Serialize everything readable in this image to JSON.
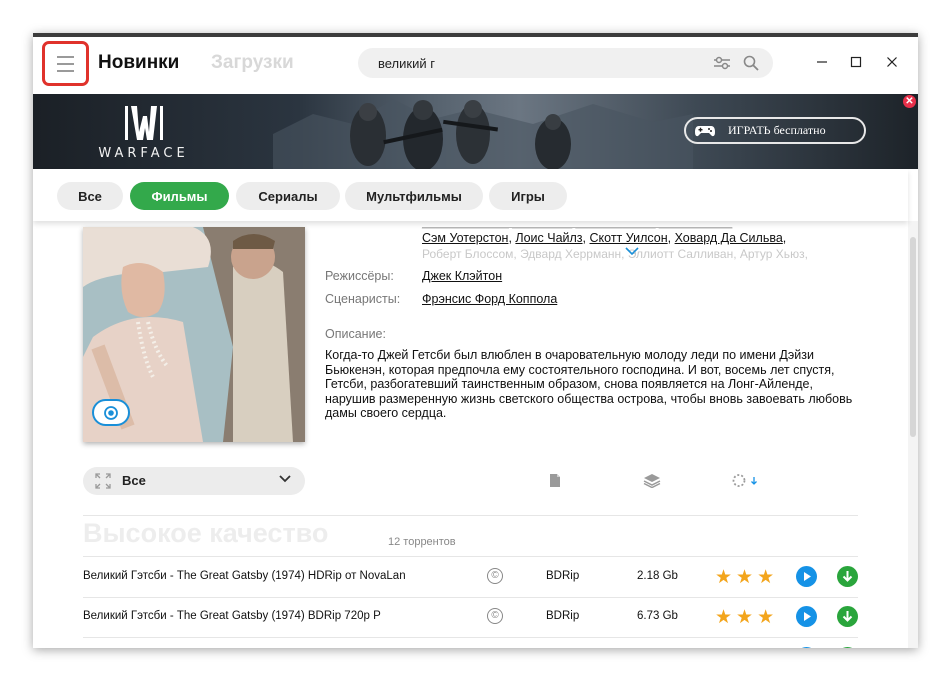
{
  "header": {
    "tab_new": "Новинки",
    "tab_downloads": "Загрузки",
    "search_value": "великий г"
  },
  "banner": {
    "logo_text": "WARFACE",
    "play_label": "ИГРАТЬ бесплатно"
  },
  "categories": [
    "Все",
    "Фильмы",
    "Сериалы",
    "Мультфильмы",
    "Игры"
  ],
  "active_category": "Фильмы",
  "movie": {
    "cast_visible": [
      "Сэм Уотерстон",
      "Лоис Чайлз",
      "Скотт Уилсон",
      "Ховард Да Сильва"
    ],
    "cast_faded": "Роберт Блоссом, Эдвард Херрманн, Эллиотт Салливан, Артур Хьюз,",
    "directors_label": "Режиссёры:",
    "directors": "Джек Клэйтон",
    "writers_label": "Сценаристы:",
    "writers": "Фрэнсис Форд Коппола",
    "description_label": "Описание:",
    "description": "Когда-то Джей Гетсби был влюблен в очаровательную молоду леди по имени Дэйзи Бьюкенэн, которая предпочла ему состоятельного господина. И вот, восемь лет спустя, Гетсби, разбогатевший таинственным образом, снова появляется на Лонг-Айленде, нарушив размеренную жизнь светского общества острова, чтобы вновь завоевать любовь дамы своего сердца."
  },
  "filter": {
    "selected": "Все"
  },
  "section": {
    "title": "Высокое качество",
    "count": "12 торрентов"
  },
  "torrents": [
    {
      "name": "Великий Гэтсби - The Great Gatsby (1974) HDRip от NovaLan",
      "format": "BDRip",
      "size": "2.18 Gb",
      "rating": 3
    },
    {
      "name": "Великий Гэтсби - The Great Gatsby (1974) BDRip 720p P",
      "format": "BDRip",
      "size": "6.73 Gb",
      "rating": 3
    }
  ],
  "colors": {
    "accent_green": "#33a94b",
    "play_blue": "#1592e6",
    "star_orange": "#f3a51c",
    "highlight_red": "#e0322b"
  }
}
